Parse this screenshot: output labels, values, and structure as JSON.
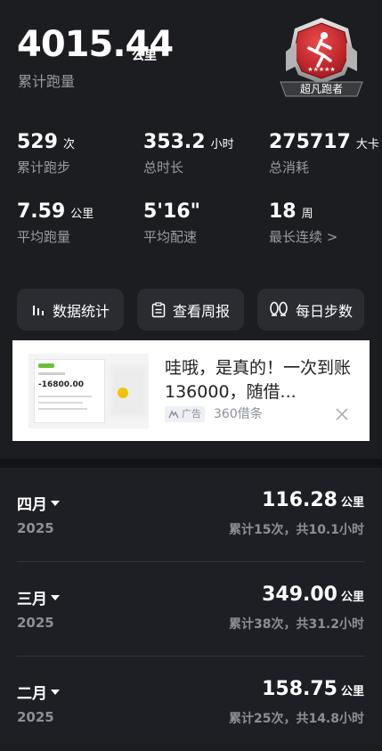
{
  "summary": {
    "total_distance": "4015.44",
    "total_unit": "公里",
    "total_label": "累计跑量",
    "badge_text": "超凡跑者"
  },
  "stats": [
    {
      "value": "529",
      "unit": "次",
      "label": "累计跑步"
    },
    {
      "value": "353.2",
      "unit": "小时",
      "label": "总时长"
    },
    {
      "value": "275717",
      "unit": "大卡",
      "label": "总消耗"
    },
    {
      "value": "7.59",
      "unit": "公里",
      "label": "平均跑量"
    },
    {
      "value": "5'16\"",
      "unit": "",
      "label": "平均配速"
    },
    {
      "value": "18",
      "unit": "周",
      "label": "最长连续 >"
    }
  ],
  "actions": [
    {
      "label": "数据统计",
      "icon": "bar-chart-icon"
    },
    {
      "label": "查看周报",
      "icon": "report-icon"
    },
    {
      "label": "每日步数",
      "icon": "footprints-icon"
    }
  ],
  "ad": {
    "title": "哇哦，是真的！一次到账136000，随借...",
    "tag": "广告",
    "source": "360借条",
    "thumb_amount": "-16800.00"
  },
  "months": [
    {
      "month": "四月",
      "year": "2025",
      "distance": "116.28",
      "unit": "公里",
      "summary": "累计15次，共10.1小时"
    },
    {
      "month": "三月",
      "year": "2025",
      "distance": "349.00",
      "unit": "公里",
      "summary": "累计38次，共31.2小时"
    },
    {
      "month": "二月",
      "year": "2025",
      "distance": "158.75",
      "unit": "公里",
      "summary": "累计25次，共14.8小时"
    }
  ],
  "colors": {
    "background": "#1c1d21",
    "card": "#2b2c31",
    "muted_text": "#9a9ba1",
    "badge_red": "#d0242b"
  }
}
